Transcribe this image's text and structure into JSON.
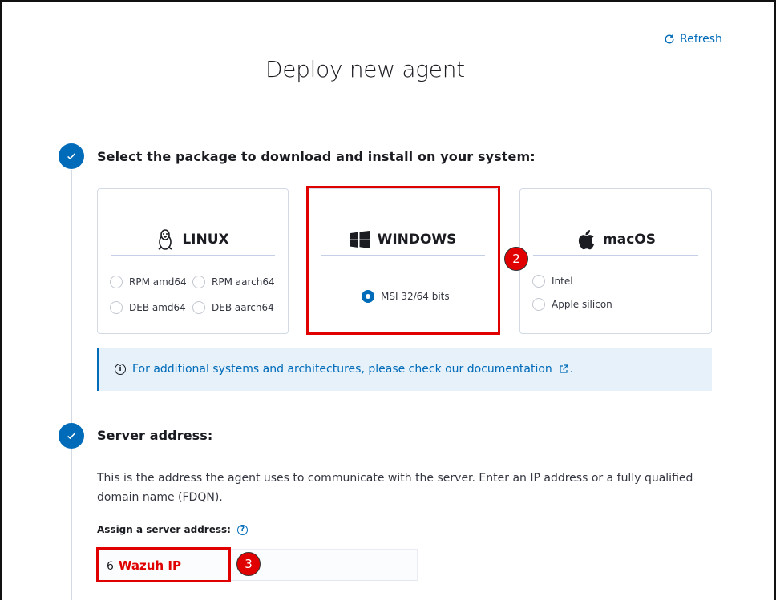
{
  "header": {
    "title": "Deploy new agent",
    "refresh_label": "Refresh"
  },
  "step1": {
    "title": "Select the package to download and install on your system:",
    "cards": {
      "linux": {
        "label": "LINUX",
        "options": [
          "RPM amd64",
          "RPM aarch64",
          "DEB amd64",
          "DEB aarch64"
        ]
      },
      "windows": {
        "label": "WINDOWS",
        "options": [
          "MSI 32/64 bits"
        ],
        "selected": "MSI 32/64 bits"
      },
      "macos": {
        "label": "macOS",
        "options": [
          "Intel",
          "Apple silicon"
        ]
      }
    },
    "callout": "For additional systems and architectures, please check our documentation",
    "callout_suffix": "."
  },
  "step2": {
    "title": "Server address:",
    "description": "This is the address the agent uses to communicate with the server. Enter an IP address or a fully qualified domain name (FDQN).",
    "field_label": "Assign a server address:",
    "input_value_prefix": "6",
    "input_value_annotation": "Wazuh IP"
  },
  "annotations": {
    "badge_2": "2",
    "badge_3": "3"
  },
  "colors": {
    "accent": "#006bb8",
    "highlight": "#e00000",
    "callout_bg": "#e6f1fa"
  }
}
